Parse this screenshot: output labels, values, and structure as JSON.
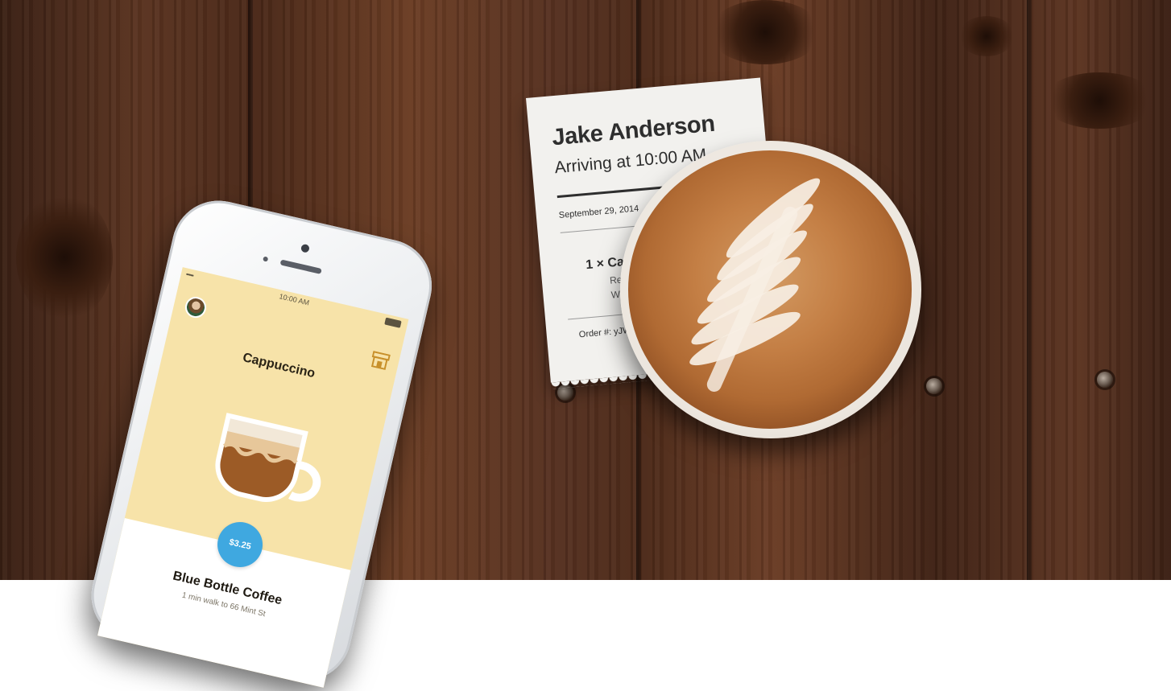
{
  "receipt": {
    "name": "Jake Anderson",
    "arrival": "Arriving at 10:00 AM",
    "date": "September 29, 2014",
    "item_line": "1 × Capp",
    "modifiers": [
      "Regula",
      "Whole"
    ],
    "order": "Order #: yJW5"
  },
  "phone": {
    "status_signal": "•••••",
    "status_time": "10:00 AM",
    "drink_title": "Cappuccino",
    "price": "$3.25",
    "shop_name": "Blue Bottle Coffee",
    "walk_info": "1 min walk to 66 Mint St"
  },
  "colors": {
    "screen_background": "#f7e3a9",
    "price_badge": "#3fa8e0",
    "wood": "#4f2c1b"
  },
  "icons": [
    "avatar-icon",
    "store-icon",
    "coffee-cup-icon"
  ]
}
